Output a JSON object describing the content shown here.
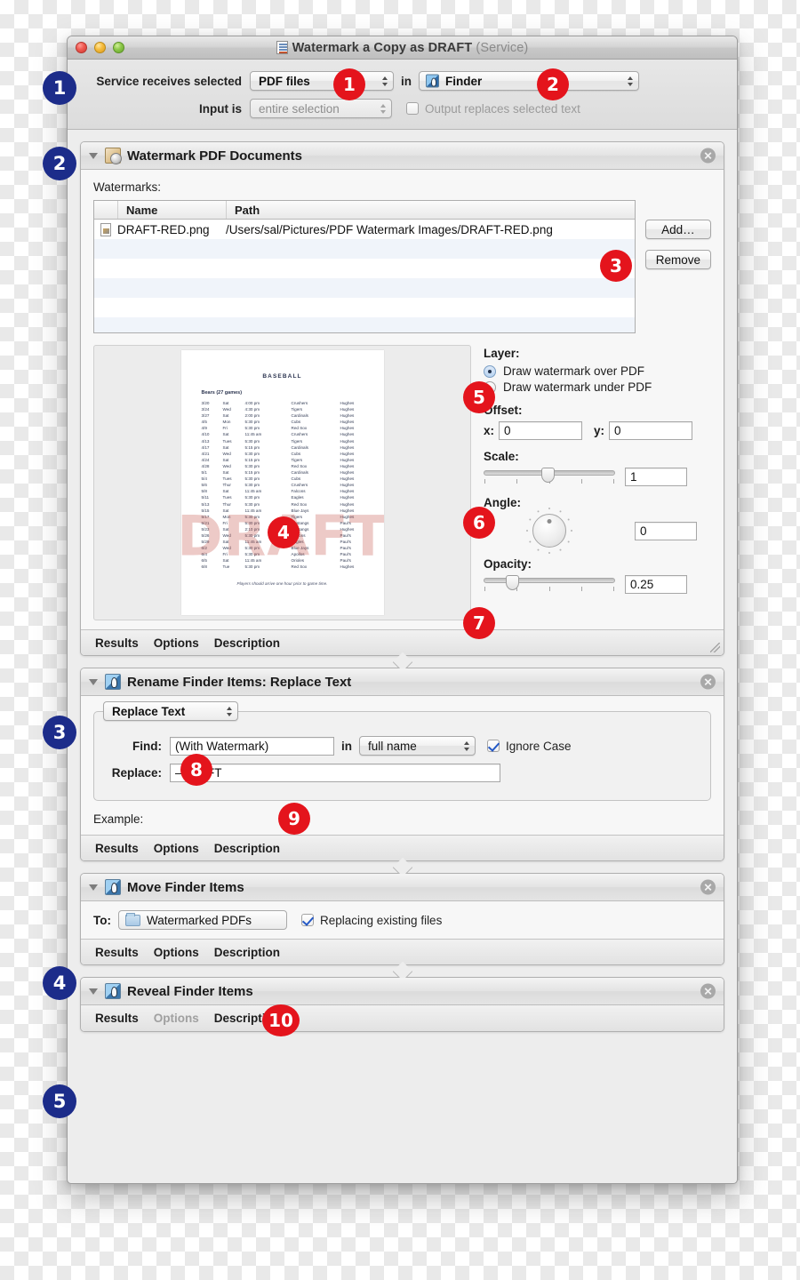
{
  "window": {
    "title": "Watermark a Copy as DRAFT",
    "title_suffix": "(Service)",
    "title_icon": "automator-document-icon"
  },
  "service_config": {
    "receives_label": "Service receives selected",
    "receives_value": "PDF files",
    "in_word": "in",
    "app_value": "Finder",
    "input_label": "Input is",
    "input_value": "entire selection",
    "output_checkbox_label": "Output replaces selected text",
    "output_checked": false
  },
  "actions": [
    {
      "title": "Watermark PDF Documents",
      "icon": "watermark-icon",
      "watermarks_label": "Watermarks:",
      "table": {
        "columns": [
          "",
          "Name",
          "Path"
        ],
        "rows": [
          {
            "name": "DRAFT-RED.png",
            "path": "/Users/sal/Pictures/PDF Watermark Images/DRAFT-RED.png"
          }
        ]
      },
      "buttons": {
        "add": "Add…",
        "remove": "Remove"
      },
      "layer": {
        "label": "Layer:",
        "options": [
          "Draw watermark over PDF",
          "Draw watermark under PDF"
        ],
        "selected": 0
      },
      "offset": {
        "label": "Offset:",
        "x_label": "x:",
        "x_value": "0",
        "y_label": "y:",
        "y_value": "0"
      },
      "scale": {
        "label": "Scale:",
        "value": "1",
        "slider_percent": 44
      },
      "angle": {
        "label": "Angle:",
        "value": "0"
      },
      "opacity": {
        "label": "Opacity:",
        "value": "0.25",
        "slider_percent": 17
      },
      "footer": [
        "Results",
        "Options",
        "Description"
      ]
    },
    {
      "title": "Rename Finder Items: Replace Text",
      "icon": "finder-icon",
      "mode_value": "Replace Text",
      "find_label": "Find:",
      "find_value": "(With Watermark)",
      "in_word": "in",
      "scope_value": "full name",
      "ignore_case_label": "Ignore Case",
      "ignore_case_checked": true,
      "replace_label": "Replace:",
      "replace_value": "–DRAFT",
      "example_label": "Example:",
      "footer": [
        "Results",
        "Options",
        "Description"
      ]
    },
    {
      "title": "Move Finder Items",
      "icon": "finder-icon",
      "to_label": "To:",
      "destination": "Watermarked PDFs",
      "replacing_label": "Replacing existing files",
      "replacing_checked": true,
      "footer": [
        "Results",
        "Options",
        "Description"
      ]
    },
    {
      "title": "Reveal Finder Items",
      "icon": "finder-icon",
      "footer": [
        "Results",
        "Options",
        "Description"
      ]
    }
  ],
  "preview_document": {
    "title": "BASEBALL",
    "subtitle": "Bears (27 games)",
    "watermark_text": "DRAFT",
    "note": "Players should arrive one hour prior to game time.",
    "rows": [
      [
        "3/20",
        "Sat",
        "4:00 pm",
        "Crushers",
        "Hughes"
      ],
      [
        "3/24",
        "Wed",
        "4:30 pm",
        "Tigers",
        "Hughes"
      ],
      [
        "3/27",
        "Sat",
        "2:00 pm",
        "Cardinals",
        "Hughes"
      ],
      [
        "4/5",
        "Mon",
        "5:30 pm",
        "Cubs",
        "Hughes"
      ],
      [
        "4/9",
        "Fri",
        "5:30 pm",
        "Red Sox",
        "Hughes"
      ],
      [
        "4/10",
        "Sat",
        "11:45 am",
        "Crushers",
        "Hughes"
      ],
      [
        "4/13",
        "Tues",
        "5:30 pm",
        "Tigers",
        "Hughes"
      ],
      [
        "4/17",
        "Sat",
        "5:15 pm",
        "Cardinals",
        "Hughes"
      ],
      [
        "4/21",
        "Wed",
        "5:30 pm",
        "Cubs",
        "Hughes"
      ],
      [
        "4/24",
        "Sat",
        "5:15 pm",
        "Tigers",
        "Hughes"
      ],
      [
        "4/28",
        "Wed",
        "5:30 pm",
        "Red Sox",
        "Hughes"
      ],
      [
        "5/1",
        "Sat",
        "5:15 pm",
        "Cardinals",
        "Hughes"
      ],
      [
        "5/4",
        "Tues",
        "5:30 pm",
        "Cubs",
        "Hughes"
      ],
      [
        "5/6",
        "Thur",
        "5:30 pm",
        "Crushers",
        "Hughes"
      ],
      [
        "5/8",
        "Sat",
        "11:45 am",
        "Falcons",
        "Hughes"
      ],
      [
        "5/11",
        "Tues",
        "5:30 pm",
        "Eagles",
        "Hughes"
      ],
      [
        "5/13",
        "Thur",
        "5:30 pm",
        "Red Sox",
        "Hughes"
      ],
      [
        "5/15",
        "Sat",
        "11:45 am",
        "Blue Jays",
        "Hughes"
      ],
      [
        "5/17",
        "Mon",
        "5:30 pm",
        "Tigers",
        "Hughes"
      ],
      [
        "5/21",
        "Fri",
        "5:30 pm",
        "Mustangs",
        "Paul's"
      ],
      [
        "5/23",
        "Sat",
        "2:10 pm",
        "Mustangs",
        "Hughes"
      ],
      [
        "5/26",
        "Wed",
        "5:30 pm",
        "Falcons",
        "Paul's"
      ],
      [
        "5/29",
        "Sat",
        "11:45 am",
        "Eagles",
        "Paul's"
      ],
      [
        "6/2",
        "Wed",
        "5:30 pm",
        "Blue Jays",
        "Paul's"
      ],
      [
        "6/4",
        "Fri",
        "5:30 pm",
        "Apollos",
        "Paul's"
      ],
      [
        "6/5",
        "Sat",
        "11:45 am",
        "Orioles",
        "Paul's"
      ],
      [
        "6/8",
        "Tue",
        "5:30 pm",
        "Red Sox",
        "Hughes"
      ]
    ]
  },
  "markers": {
    "blue": [
      "1",
      "2",
      "3",
      "4",
      "5"
    ],
    "red": [
      "1",
      "2",
      "3",
      "4",
      "5",
      "6",
      "7",
      "8",
      "9",
      "10"
    ]
  },
  "colors": {
    "marker_blue": "#1c2c8a",
    "marker_red": "#e4141c",
    "watermark_red": "#c45046"
  }
}
